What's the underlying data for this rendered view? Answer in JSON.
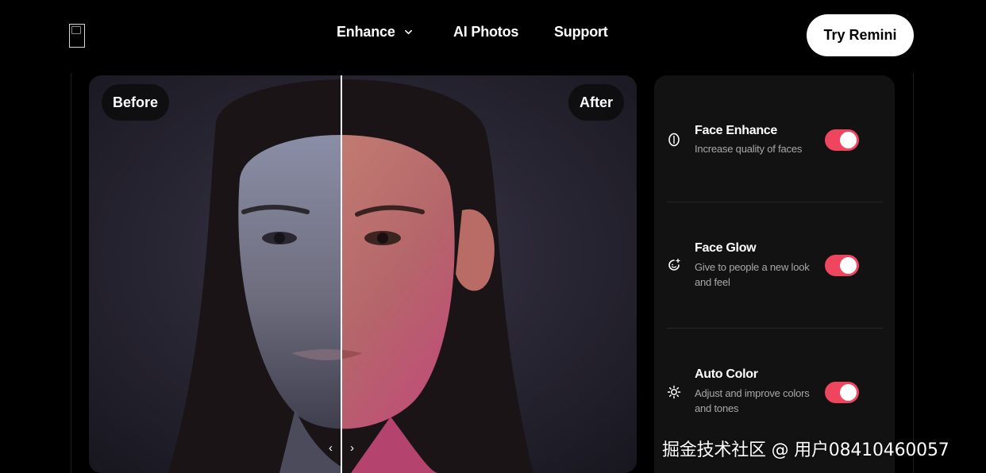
{
  "header": {
    "nav": [
      {
        "label": "Enhance",
        "has_dropdown": true
      },
      {
        "label": "AI Photos"
      },
      {
        "label": "Support"
      }
    ],
    "cta_label": "Try Remini"
  },
  "compare": {
    "before_label": "Before",
    "after_label": "After",
    "handle_left": "‹",
    "handle_right": "›",
    "slider_position_percent": 46
  },
  "settings": [
    {
      "icon": "face-icon",
      "title": "Face Enhance",
      "description": "Increase quality of faces",
      "enabled": true
    },
    {
      "icon": "face-glow-icon",
      "title": "Face Glow",
      "description": "Give to people a new look and feel",
      "enabled": true
    },
    {
      "icon": "sun-icon",
      "title": "Auto Color",
      "description": "Adjust and improve colors and tones",
      "enabled": true
    }
  ],
  "watermark": "掘金技术社区 @ 用户08410460057",
  "colors": {
    "background": "#000000",
    "panel": "#121212",
    "toggle_on": "#f0455f",
    "cta_bg": "#ffffff"
  }
}
